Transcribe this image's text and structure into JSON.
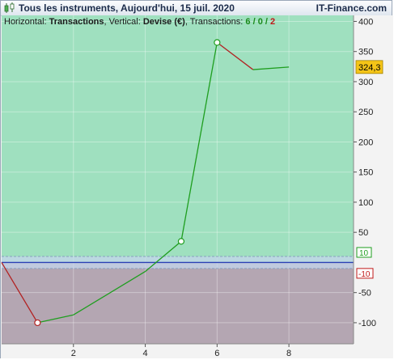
{
  "window": {
    "title": "Tous les instruments, Aujourd'hui, 15 juil. 2020",
    "brand": "IT-Finance.com"
  },
  "legend": {
    "horizontal_label": "Horizontal:",
    "horizontal_value": "Transactions",
    "vertical_label": "Vertical:",
    "vertical_value": "Devise (€)",
    "transactions_label": "Transactions:",
    "wins": "6",
    "sep1": " / ",
    "neutral": "0",
    "sep2": " / ",
    "losses": "2"
  },
  "colors": {
    "profit_zone": "#9fe0bf",
    "loss_zone": "#b4a6b2",
    "band": "#c4d6ec",
    "zero_line": "#2a3fb4",
    "win_segment": "#1f9e1f",
    "loss_segment": "#b22222",
    "last_value_badge": "#f5c518",
    "upper_bound_color": "#1f9e1f",
    "lower_bound_color": "#c01818"
  },
  "chart_data": {
    "type": "line",
    "xlabel": "",
    "ylabel": "",
    "xlim": [
      0,
      9.8
    ],
    "ylim": [
      -135,
      410
    ],
    "x_ticks": [
      2,
      4,
      6,
      8
    ],
    "y_ticks": [
      -100,
      -50,
      50,
      100,
      150,
      200,
      250,
      300,
      350,
      400
    ],
    "points": [
      {
        "x": 0,
        "y": 0
      },
      {
        "x": 1,
        "y": -100
      },
      {
        "x": 2,
        "y": -87
      },
      {
        "x": 4,
        "y": -15
      },
      {
        "x": 5,
        "y": 35
      },
      {
        "x": 6,
        "y": 365
      },
      {
        "x": 7,
        "y": 320
      },
      {
        "x": 8,
        "y": 324.3
      }
    ],
    "markers": [
      {
        "x": 1,
        "y": -100
      },
      {
        "x": 5,
        "y": 35
      },
      {
        "x": 6,
        "y": 365
      }
    ],
    "upper_bound": 10,
    "lower_bound": -10,
    "upper_bound_label": "10",
    "lower_bound_label": "-10",
    "last_value": 324.3,
    "last_value_label": "324,3",
    "grid": true,
    "legend": "none"
  }
}
